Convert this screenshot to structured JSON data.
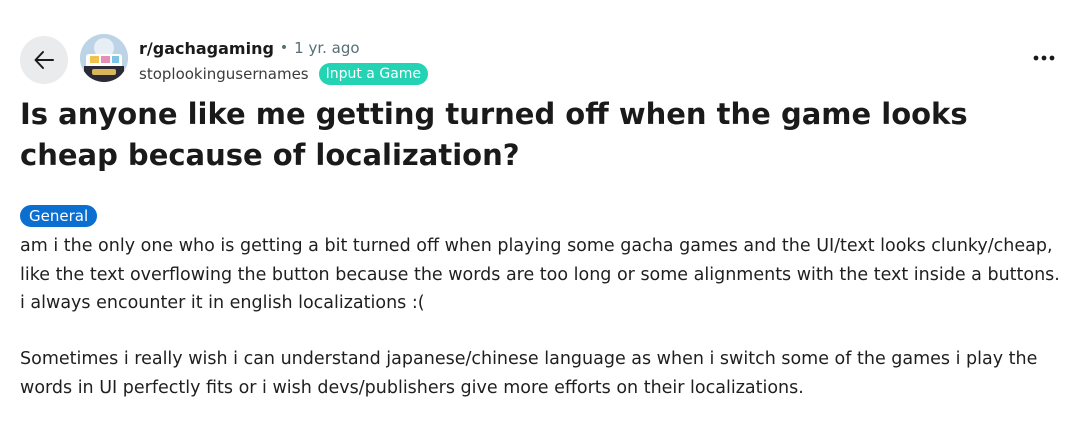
{
  "post": {
    "subreddit": "r/gachagaming",
    "separator": "•",
    "age": "1 yr. ago",
    "username": "stoplookingusernames",
    "user_flair": "Input a Game",
    "title": "Is anyone like me getting turned off when the game looks cheap because of localization?",
    "post_flair": "General",
    "paragraphs": [
      "am i the only one who is getting a bit turned off when playing some gacha games and the UI/text looks clunky/cheap, like the text overflowing the button because the words are too long or some alignments with the text inside a buttons. i always encounter it in english localizations :(",
      "Sometimes i really wish i can understand japanese/chinese language as when i switch some of the games i play the words in UI perfectly fits or i wish devs/publishers give more efforts on their localizations."
    ]
  },
  "icons": {
    "back": "arrow-left-icon",
    "more": "more-options-icon"
  },
  "colors": {
    "user_flair_bg": "#24d3b4",
    "post_flair_bg": "#0a6fd1",
    "back_button_bg": "#e9ebed"
  }
}
